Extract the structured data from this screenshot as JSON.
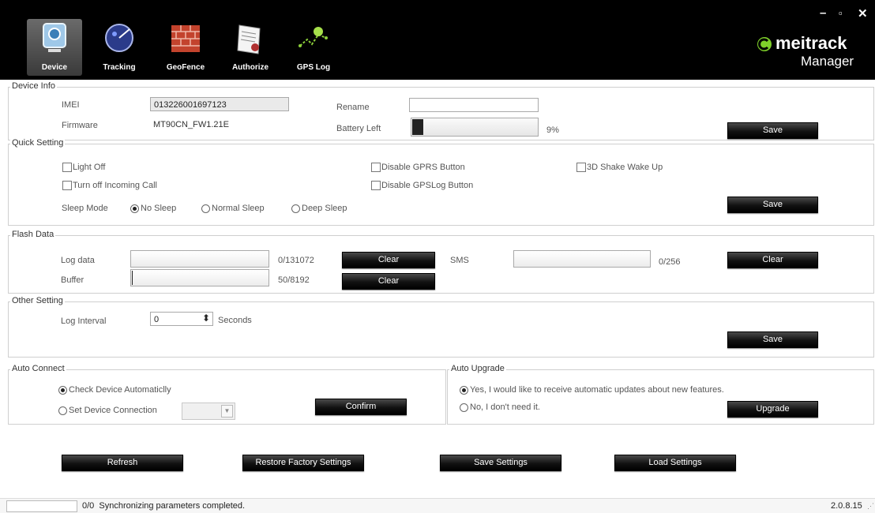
{
  "toolbar": {
    "items": [
      {
        "label": "Device",
        "icon": "device-icon"
      },
      {
        "label": "Tracking",
        "icon": "globe-icon"
      },
      {
        "label": "GeoFence",
        "icon": "brick-wall-icon"
      },
      {
        "label": "Authorize",
        "icon": "certificate-icon"
      },
      {
        "label": "GPS Log",
        "icon": "route-icon"
      }
    ],
    "brand": "meitrack",
    "brand_sub": "Manager",
    "window_controls": {
      "minimize": "–",
      "maximize": "▫",
      "close": "✕"
    }
  },
  "device_info": {
    "title": "Device Info",
    "imei_label": "IMEI",
    "imei_value": "013226001697123",
    "firmware_label": "Firmware",
    "firmware_value": "MT90CN_FW1.21E",
    "rename_label": "Rename",
    "rename_value": "",
    "battery_label": "Battery Left",
    "battery_percent": 9,
    "battery_text": "9%",
    "save_label": "Save"
  },
  "quick_setting": {
    "title": "Quick Setting",
    "light_off": "Light Off",
    "turn_off_call": "Turn off Incoming Call",
    "disable_gprs": "Disable GPRS Button",
    "disable_gpslog": "Disable GPSLog Button",
    "shake_wake": "3D Shake Wake Up",
    "sleep_mode_label": "Sleep Mode",
    "sleep_options": [
      "No Sleep",
      "Normal Sleep",
      "Deep Sleep"
    ],
    "sleep_selected": "No Sleep",
    "save_label": "Save"
  },
  "flash_data": {
    "title": "Flash Data",
    "log_label": "Log data",
    "log_count": "0/131072",
    "buffer_label": "Buffer",
    "buffer_count": "50/8192",
    "sms_label": "SMS",
    "sms_count": "0/256",
    "clear_label": "Clear"
  },
  "other_setting": {
    "title": "Other Setting",
    "interval_label": "Log Interval",
    "interval_value": "0",
    "unit": "Seconds",
    "save_label": "Save"
  },
  "auto_connect": {
    "title": "Auto Connect",
    "check_auto": "Check Device Automaticlly",
    "set_connection": "Set Device Connection",
    "confirm_label": "Confirm"
  },
  "auto_upgrade": {
    "title": "Auto Upgrade",
    "yes_option": "Yes, I would like to receive automatic updates about new features.",
    "no_option": "No, I don't need it.",
    "upgrade_label": "Upgrade"
  },
  "actions": {
    "refresh": "Refresh",
    "restore": "Restore Factory Settings",
    "save_settings": "Save Settings",
    "load_settings": "Load Settings"
  },
  "status": {
    "message": "0/0  Synchronizing parameters completed.",
    "version": "2.0.8.15"
  }
}
